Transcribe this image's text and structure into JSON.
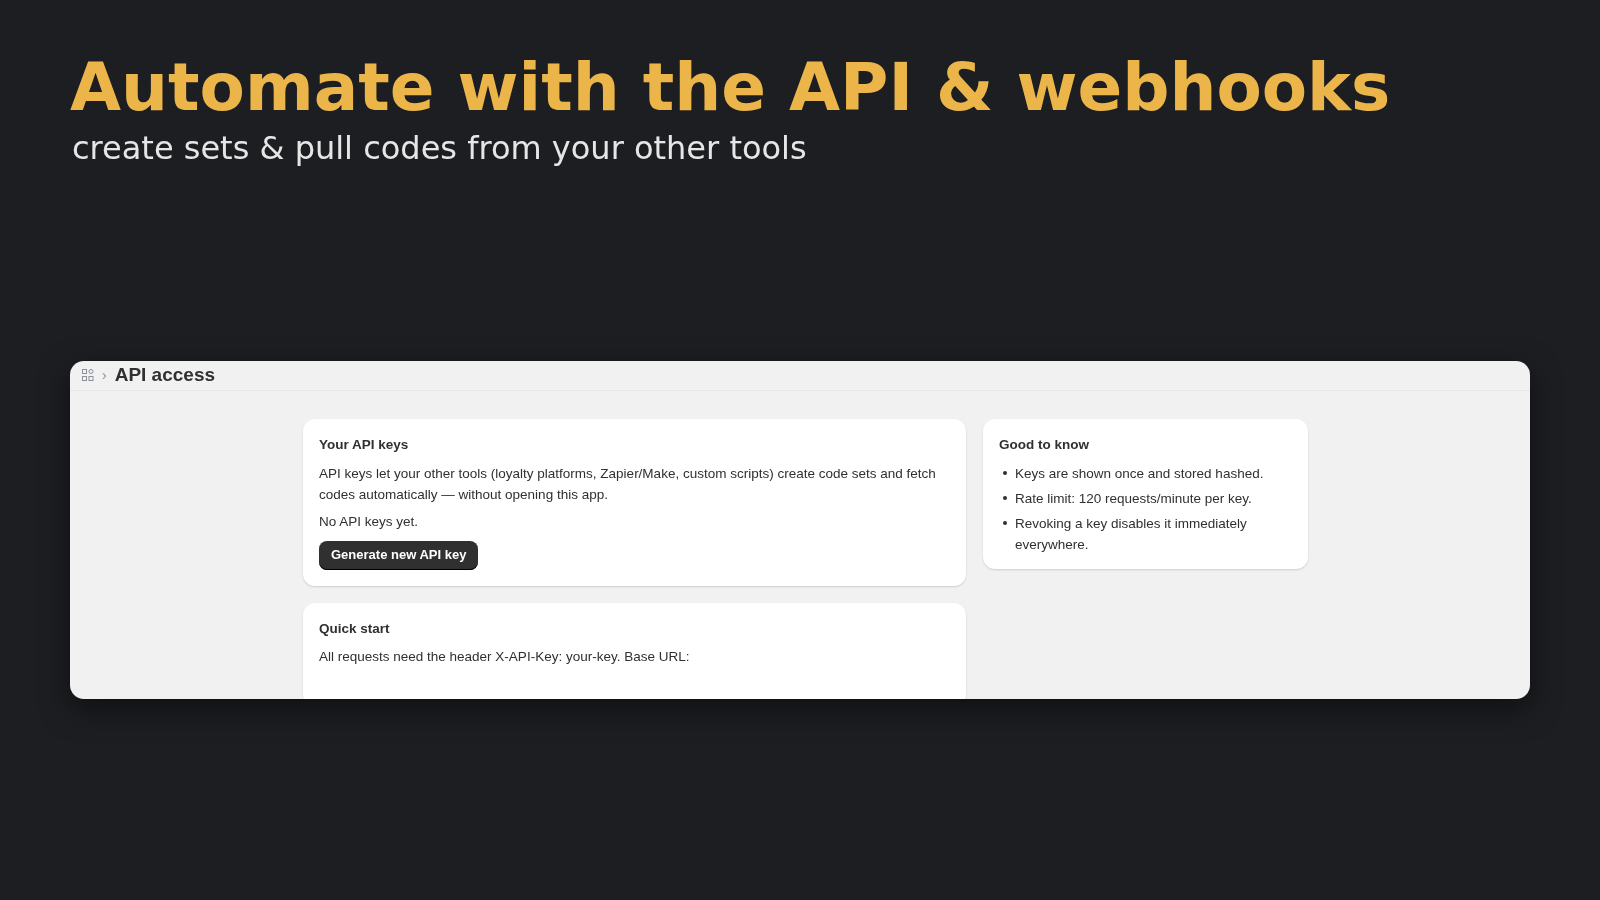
{
  "headline": "Automate with the API & webhooks",
  "subheadline": "create sets & pull codes from your other tools",
  "app": {
    "breadcrumb_separator": "›",
    "page_title": "API access",
    "api_keys_card": {
      "title": "Your API keys",
      "description": "API keys let your other tools (loyalty platforms, Zapier/Make, custom scripts) create code sets and fetch codes automatically — without opening this app.",
      "empty_state": "No API keys yet.",
      "button": "Generate new API key"
    },
    "quick_start_card": {
      "title": "Quick start",
      "description": "All requests need the header X-API-Key: your-key. Base URL:"
    },
    "good_to_know_card": {
      "title": "Good to know",
      "items": [
        "Keys are shown once and stored hashed.",
        "Rate limit: 120 requests/minute per key.",
        "Revoking a key disables it immediately everywhere."
      ]
    }
  }
}
